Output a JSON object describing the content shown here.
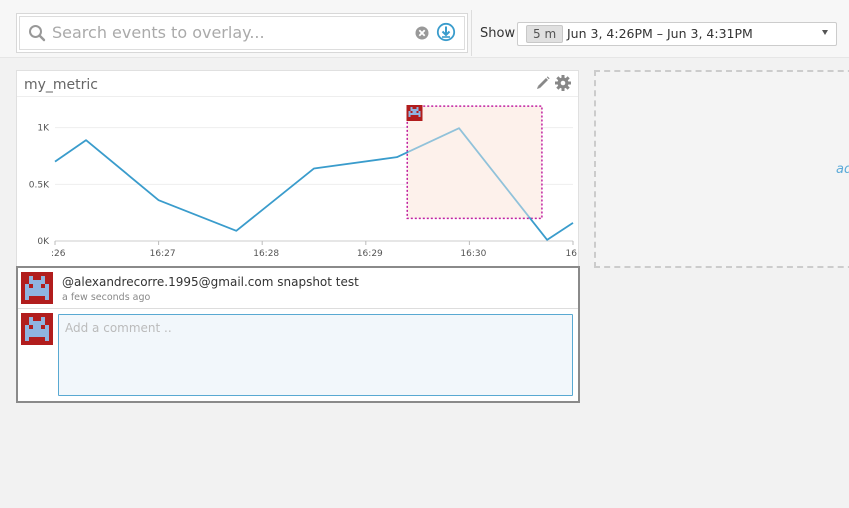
{
  "search": {
    "placeholder": "Search events to overlay...",
    "icon": "search-icon",
    "clear_icon": "clear-icon",
    "submit_icon": "download-icon"
  },
  "timeframe": {
    "show_label": "Show",
    "duration_badge": "5 m",
    "range_label": "Jun 3, 4:26PM – Jun 3, 4:31PM"
  },
  "widget": {
    "title": "my_metric",
    "edit_icon": "pencil-icon",
    "settings_icon": "gear-icon"
  },
  "placeholder": {
    "text": "ad"
  },
  "chart_data": {
    "type": "line",
    "ylim": [
      0,
      1200
    ],
    "yticks": [
      {
        "value": 0,
        "label": "0K"
      },
      {
        "value": 500,
        "label": "0.5K"
      },
      {
        "value": 1000,
        "label": "1K"
      }
    ],
    "xlim": [
      0,
      5.0
    ],
    "xticks": [
      {
        "value": 0.0,
        "label": ":26"
      },
      {
        "value": 1.0,
        "label": "16:27"
      },
      {
        "value": 2.0,
        "label": "16:28"
      },
      {
        "value": 3.0,
        "label": "16:29"
      },
      {
        "value": 4.0,
        "label": "16:30"
      },
      {
        "value": 5.0,
        "label": "16"
      }
    ],
    "series": [
      {
        "color": "#3a9ccc",
        "points": [
          [
            0.0,
            700
          ],
          [
            0.3,
            890
          ],
          [
            1.0,
            360
          ],
          [
            1.75,
            90
          ],
          [
            2.5,
            640
          ],
          [
            3.3,
            740
          ],
          [
            3.9,
            995
          ],
          [
            4.75,
            10
          ],
          [
            5.0,
            160
          ]
        ]
      }
    ],
    "grid": true,
    "selection": {
      "x0": 3.4,
      "x1": 4.7,
      "y0": 200,
      "y1": 1190,
      "color": "#c020a0"
    }
  },
  "comments": {
    "author_line": "@alexandrecorre.1995@gmail.com snapshot test",
    "timestamp": "a few seconds ago",
    "avatar_icon": "space-invader-avatar-icon",
    "input_placeholder": "Add a comment .."
  }
}
